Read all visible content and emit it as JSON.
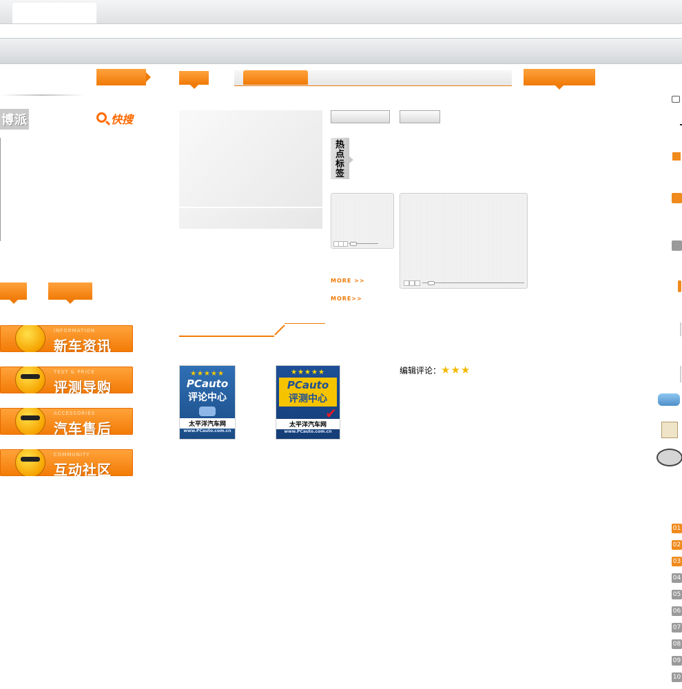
{
  "header": {
    "top_tab": "",
    "nav_text": ""
  },
  "left": {
    "brand": "博派",
    "search_label": "快搜",
    "categories": [
      {
        "en": "INFORMATION",
        "cn": "新车资讯",
        "icon": "megaphone-mascot-icon"
      },
      {
        "en": "TEST & PRICE",
        "cn": "评测导购",
        "icon": "car-mascot-icon"
      },
      {
        "en": "ACCESSORIES",
        "cn": "汽车售后",
        "icon": "wrench-mascot-icon"
      },
      {
        "en": "COMMUNITY",
        "cn": "互动社区",
        "icon": "sunglasses-mascot-icon"
      }
    ]
  },
  "center": {
    "hot_tags_label": "热点标签",
    "more1": "MORE >>",
    "more2": "MORE>>",
    "badges": [
      {
        "stars": "★★★★★",
        "brand": "PCauto",
        "title": "评论中心",
        "site": "太平洋汽车网",
        "url": "www.PCauto.com.cn"
      },
      {
        "stars": "★★★★★",
        "brand": "PCauto",
        "title": "评测中心",
        "site": "太平洋汽车网",
        "url": "www.PCauto.com.cn"
      }
    ],
    "editor_label": "编辑评论：",
    "editor_stars": "★★★"
  },
  "right": {
    "ranks": [
      "01",
      "02",
      "03",
      "04",
      "05",
      "06",
      "07",
      "08",
      "09",
      "10"
    ],
    "rank_highlight_count": 3
  },
  "colors": {
    "accent": "#f07a06",
    "grey": "#9a9a9a"
  }
}
